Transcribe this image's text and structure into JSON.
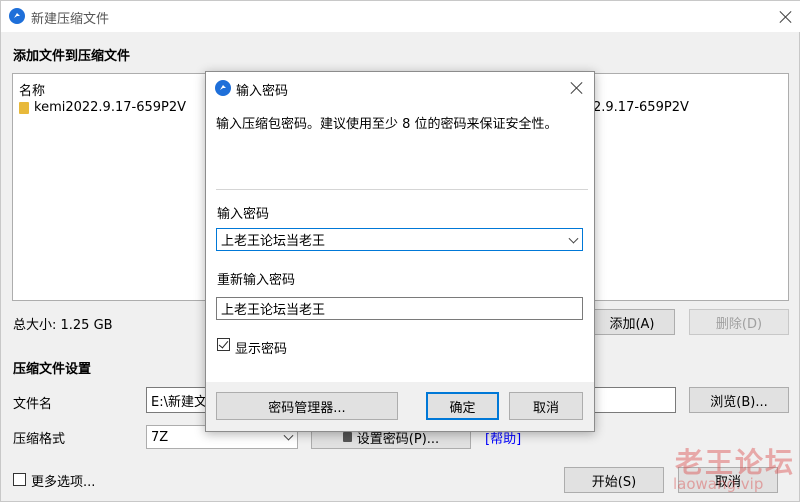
{
  "main": {
    "title": "新建压缩文件",
    "section_add": "添加文件到压缩文件",
    "list": {
      "col_name": "名称",
      "rows": [
        "kemi2022.9.17-659P2V"
      ],
      "right_fragment": "2.9.17-659P2V"
    },
    "total_size": "总大小: 1.25 GB",
    "add_button": "添加(A)",
    "delete_button": "删除(D)",
    "section_settings": "压缩文件设置",
    "filename_label": "文件名",
    "filename_value": "E:\\新建文",
    "browse_button": "浏览(B)...",
    "format_label": "压缩格式",
    "format_value": "7Z",
    "set_password_button": "设置密码(P)...",
    "help_link": "[帮助]",
    "more_options": "更多选项...",
    "start_button": "开始(S)",
    "cancel_button": "取消"
  },
  "dialog": {
    "title": "输入密码",
    "description": "输入压缩包密码。建议使用至少 8 位的密码来保证安全性。",
    "password_label": "输入密码",
    "password_value": "上老王论坛当老王",
    "reenter_label": "重新输入密码",
    "reenter_value": "上老王论坛当老王",
    "show_password_label": "显示密码",
    "show_password_checked": true,
    "manager_button": "密码管理器...",
    "ok_button": "确定",
    "cancel_button": "取消"
  },
  "watermark": {
    "text": "老王论坛",
    "sub": "laowang.vip"
  },
  "colors": {
    "accent": "#0078d7",
    "app_icon": "#1e6fd9",
    "link": "#0000ff"
  }
}
